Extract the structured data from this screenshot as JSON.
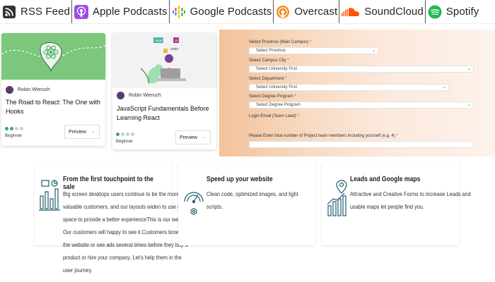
{
  "podcasts": [
    {
      "label": "RSS Feed",
      "icon": "rss-icon",
      "color": "#222222"
    },
    {
      "label": "Apple Podcasts",
      "icon": "apple-podcasts-icon",
      "color": "#8a3fd1"
    },
    {
      "label": "Google Podcasts",
      "icon": "google-podcasts-icon",
      "color": "#4285f4"
    },
    {
      "label": "Overcast",
      "icon": "overcast-icon",
      "color": "#f58a25"
    },
    {
      "label": "SoundCloud",
      "icon": "soundcloud-icon",
      "color": "#ff5500"
    },
    {
      "label": "Spotify",
      "icon": "spotify-icon",
      "color": "#1db954"
    }
  ],
  "cards": [
    {
      "author": "Robin Wieruch",
      "title": "The Road to React: The One with Hooks",
      "level": "Beginner",
      "level_dots": 2,
      "preview_label": "Preview",
      "thumb_color": "#7cc77c"
    },
    {
      "author": "Robin Wieruch",
      "title": "JavaScript Fundamentals Before Learning React",
      "level": "Beginner",
      "level_dots": 1,
      "preview_label": "Preview",
      "thumb_color": "#f2f2f2",
      "thumb_badges": [
        "REACT",
        "JS",
        "node"
      ]
    }
  ],
  "form": {
    "province_label": "Select Province (Main Campus)",
    "province_placeholder": "Select Province",
    "city_label": "Select Campus City",
    "city_placeholder": "Select University First",
    "department_label": "Select Department",
    "department_placeholder": "Select University First",
    "degree_label": "Select Degree Program",
    "degree_placeholder": "Select Degree Program",
    "email_label": "Login Email (Team Lead)",
    "members_label": "Please Enter total number of Project team members including yourself (e.g. 4)",
    "required_mark": "*"
  },
  "features": [
    {
      "title": "From the first touchpoint to the sale",
      "text": "Big screen desktops users continue to be the more valuable customers, and our layouts widen to use more space to provide a better experienceThis is our website. Our customers will happy to see it.Customers browse the website or see ads several times before they buy a product or hire your company. Let's help them in the user journey.",
      "icon": "analytics-chart-icon"
    },
    {
      "title": "Speed up your website",
      "text": "Clean code, optimized images, and light scripts.",
      "icon": "speedometer-icon"
    },
    {
      "title": "Leads and Google maps",
      "text": "Attractive and Creative Forms to increase Leads and usable maps let people find you.",
      "icon": "map-pin-chart-icon"
    }
  ]
}
